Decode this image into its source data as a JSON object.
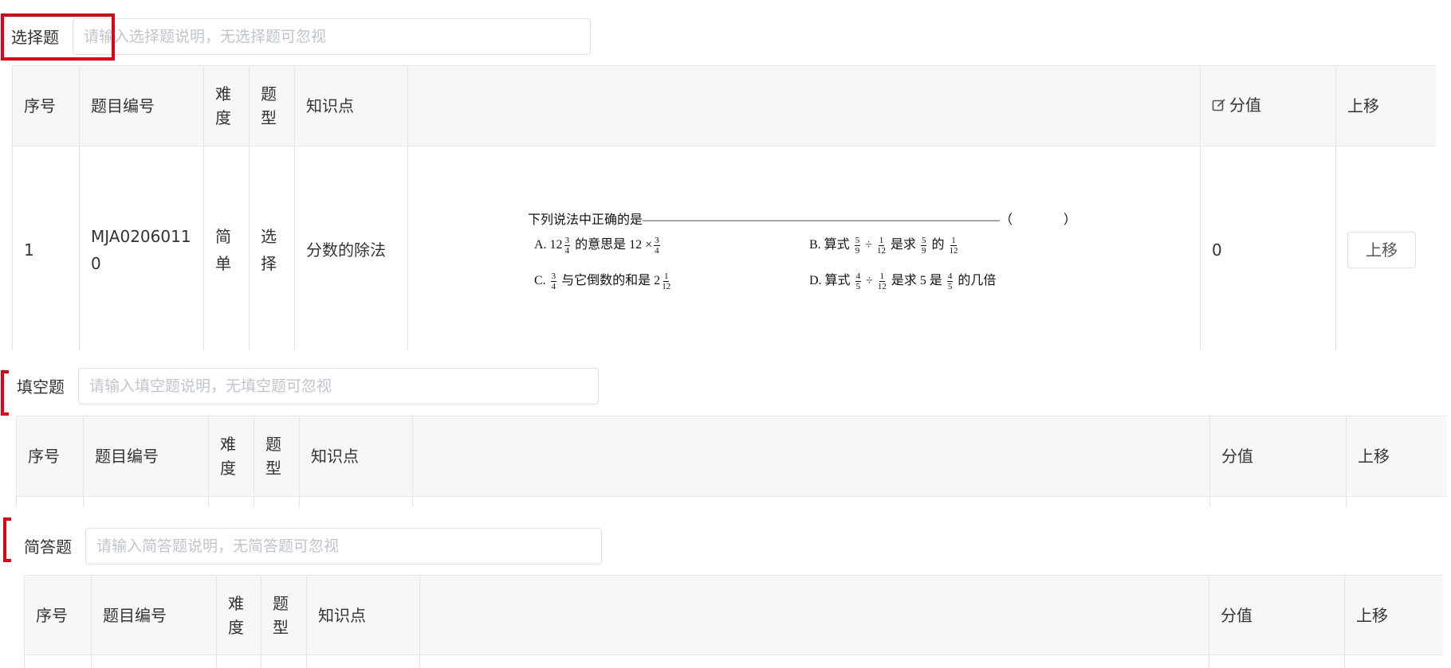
{
  "sections": [
    {
      "label": "选择题",
      "placeholder": "请输入选择题说明，无选择题可忽视",
      "headers": {
        "index": "序号",
        "code": "题目编号",
        "difficulty": "难度",
        "type": "题型",
        "knowledge": "知识点",
        "content": "",
        "score": "分值",
        "move": "上移"
      },
      "rows": [
        {
          "index": "1",
          "code": "MJA02060110",
          "difficulty": "简单",
          "type": "选择",
          "knowledge": "分数的除法",
          "score": "0",
          "move_label": "上移",
          "question": {
            "stem": "下列说法中正确的是————————————————————————————（　　　　）",
            "a": {
              "prefix": "A. 12",
              "wn": "3",
              "wd": "4",
              "mid": "的意思是 12 ×",
              "fn": "3",
              "fd": "4"
            },
            "b": {
              "prefix": "B. 算式",
              "f1n": "5",
              "f1d": "9",
              "op": "÷",
              "f2n": "1",
              "f2d": "12",
              "mid": "是求",
              "f3n": "5",
              "f3d": "9",
              "mid2": "的",
              "f4n": "1",
              "f4d": "12"
            },
            "c": {
              "prefix": "C.",
              "f1n": "3",
              "f1d": "4",
              "mid": "与它倒数的和是 2",
              "f2n": "1",
              "f2d": "12"
            },
            "d": {
              "prefix": "D. 算式",
              "f1n": "4",
              "f1d": "5",
              "op": "÷",
              "f2n": "1",
              "f2d": "12",
              "mid": "是求 5 是",
              "f3n": "4",
              "f3d": "5",
              "tail": "的几倍"
            }
          }
        }
      ]
    },
    {
      "label": "填空题",
      "placeholder": "请输入填空题说明，无填空题可忽视",
      "headers": {
        "index": "序号",
        "code": "题目编号",
        "difficulty": "难度",
        "type": "题型",
        "knowledge": "知识点",
        "content": "",
        "score": "分值",
        "move": "上移"
      }
    },
    {
      "label": "简答题",
      "placeholder": "请输入简答题说明，无简答题可忽视",
      "headers": {
        "index": "序号",
        "code": "题目编号",
        "difficulty": "难度",
        "type": "题型",
        "knowledge": "知识点",
        "content": "",
        "score": "分值",
        "move": "上移"
      }
    }
  ],
  "icons": {
    "score_edit": "edit-icon"
  },
  "colors": {
    "highlight": "#e60012",
    "header_bg": "#f7f7f7",
    "border": "#e6e6e6",
    "placeholder": "#c0c4cc"
  }
}
